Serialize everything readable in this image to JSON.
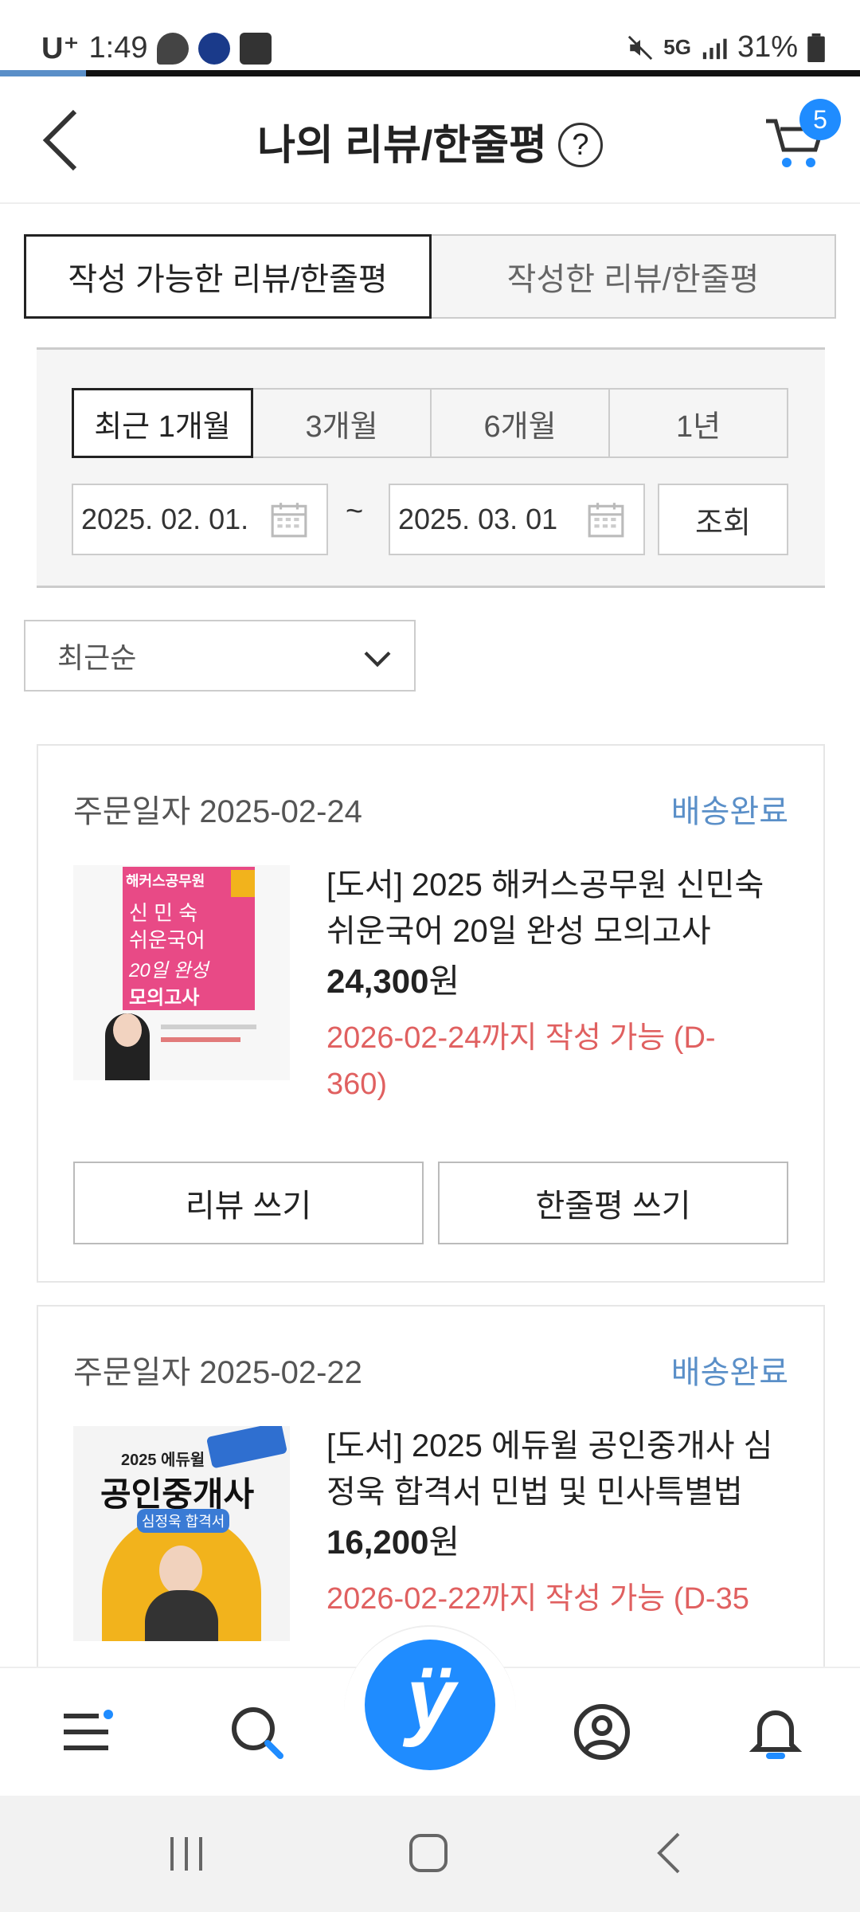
{
  "status_bar": {
    "carrier": "U⁺",
    "time": "1:49",
    "network": "5G",
    "battery": "31%"
  },
  "header": {
    "title": "나의 리뷰/한줄평",
    "help_glyph": "?",
    "cart_count": "5"
  },
  "tabs": [
    {
      "label": "작성 가능한 리뷰/한줄평",
      "active": true
    },
    {
      "label": "작성한 리뷰/한줄평",
      "active": false
    }
  ],
  "filter": {
    "periods": [
      "최근 1개월",
      "3개월",
      "6개월",
      "1년"
    ],
    "selected_period": "최근 1개월",
    "start_date": "2025. 02. 01.",
    "end_date": "2025. 03. 01",
    "range_separator": "~",
    "search_label": "조회"
  },
  "sort": {
    "selected": "최근순"
  },
  "orders": [
    {
      "order_date_label": "주문일자 2025-02-24",
      "status": "배송완료",
      "product_name": "[도서] 2025 해커스공무원 신민숙 쉬운국어 20일 완성 모의고사",
      "price_number": "24,300",
      "price_unit": "원",
      "deadline": "2026-02-24까지 작성 가능 (D-360)",
      "review_button": "리뷰 쓰기",
      "oneline_button": "한줄평 쓰기",
      "cover": {
        "publisher": "해커스공무원",
        "line1": "신 민 숙",
        "line2": "쉬운국어",
        "line3": "20일 완성",
        "line4": "모의고사",
        "colors": {
          "bg": "#f7f7f7",
          "accent": "#e84a86"
        }
      }
    },
    {
      "order_date_label": "주문일자 2025-02-22",
      "status": "배송완료",
      "product_name": "[도서] 2025 에듀윌 공인중개사 심정욱 합격서 민법 및 민사특별법",
      "price_number": "16,200",
      "price_unit": "원",
      "deadline": "2026-02-22까지 작성 가능 (D-35",
      "cover": {
        "line1": "2025 에듀윌",
        "line2": "공인중개사",
        "line3": "심정욱 합격서",
        "colors": {
          "bg": "#f4f4f4",
          "accent": "#f2b31c"
        }
      }
    }
  ],
  "colors": {
    "accent_blue": "#1f8cff",
    "status_blue": "#5a8fc8",
    "deadline_red": "#e06060"
  },
  "bottom_nav": {
    "items": [
      "menu-icon",
      "search-icon",
      "yes24-home-button",
      "my-page-icon",
      "notification-bell-icon"
    ],
    "fab_glyph": "ÿ"
  }
}
